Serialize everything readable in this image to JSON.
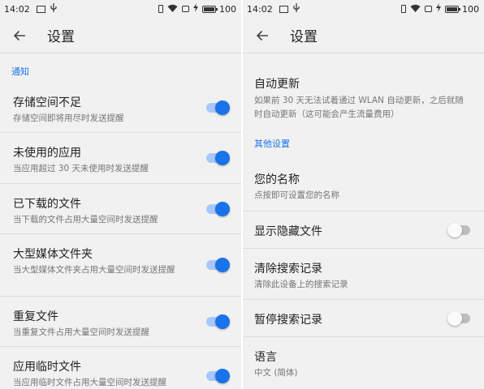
{
  "colors": {
    "accent": "#1a73e8",
    "switch_track_on": "#a8c7fa",
    "background": "#f1f1f1"
  },
  "status_bar": {
    "time": "14:02",
    "battery": "100",
    "icons": [
      "image-icon",
      "usb-icon",
      "vibrate-icon",
      "wifi-icon",
      "square-icon",
      "charging-icon",
      "battery-icon"
    ]
  },
  "left": {
    "toolbar": {
      "title": "设置",
      "back_icon": "arrow-left-icon"
    },
    "section_header": "通知",
    "items": [
      {
        "title": "存储空间不足",
        "subtitle": "存储空间即将用尽时发送提醒",
        "switch_on": true
      },
      {
        "title": "未使用的应用",
        "subtitle": "当应用超过 30 天未使用时发送提醒",
        "switch_on": true
      },
      {
        "title": "已下载的文件",
        "subtitle": "当下载的文件占用大量空间时发送提醒",
        "switch_on": true
      },
      {
        "title": "大型媒体文件夹",
        "subtitle": "当大型媒体文件夹占用大量空间时发送提醒",
        "switch_on": true
      },
      {
        "title": "重复文件",
        "subtitle": "当重复文件占用大量空间时发送提醒",
        "switch_on": true
      },
      {
        "title": "应用临时文件",
        "subtitle": "当应用临时文件占用大量空间时发送提醒",
        "switch_on": true
      }
    ]
  },
  "right": {
    "toolbar": {
      "title": "设置",
      "back_icon": "arrow-left-icon"
    },
    "auto_update": {
      "title": "自动更新",
      "subtitle": "如果前 30 天无法试着通过 WLAN 自动更新，之后就随时自动更新（这可能会产生流量费用）"
    },
    "section_header": "其他设置",
    "your_name": {
      "title": "您的名称",
      "subtitle": "点按即可设置您的名称"
    },
    "show_hidden": {
      "title": "显示隐藏文件",
      "switch_on": false
    },
    "clear_search": {
      "title": "清除搜索记录",
      "subtitle": "清除此设备上的搜索记录"
    },
    "pause_search": {
      "title": "暂停搜索记录",
      "switch_on": false
    },
    "language": {
      "title": "语言",
      "subtitle": "中文 (简体)"
    }
  }
}
